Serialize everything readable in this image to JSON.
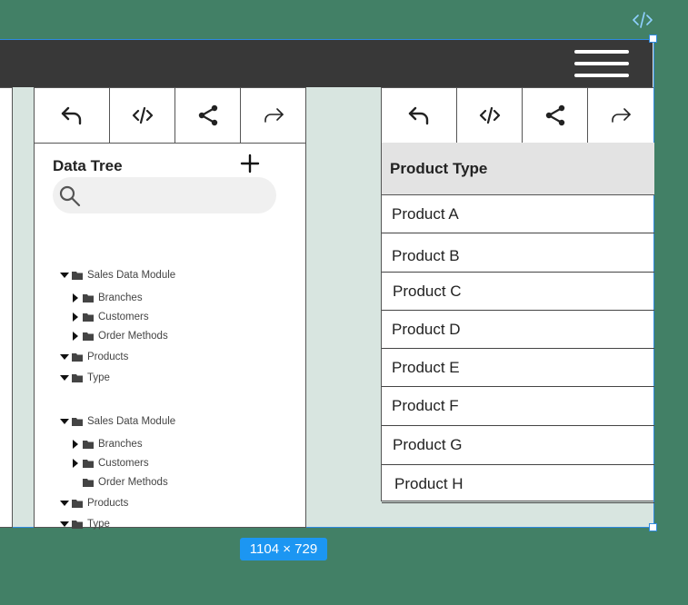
{
  "tree_panel": {
    "title": "Data Tree",
    "search_placeholder": "",
    "groups": [
      {
        "root": "Sales Data Module",
        "children": [
          "Branches",
          "Customers",
          "Order Methods"
        ],
        "siblings": [
          "Products",
          "Type"
        ]
      },
      {
        "root": "Sales Data Module",
        "children": [
          "Branches",
          "Customers",
          "Order Methods"
        ],
        "siblings": [
          "Products",
          "Type"
        ]
      }
    ]
  },
  "table_panel": {
    "header": "Product Type",
    "rows": [
      "Product A",
      "Product B",
      "Product C",
      "Product D",
      "Product E",
      "Product F",
      "Product G",
      "Product H"
    ]
  },
  "toolbar_icons": [
    "undo-icon",
    "code-icon",
    "share-icon",
    "redo-icon"
  ],
  "frame_size_badge": "1104 × 729",
  "colors": {
    "background": "#428066",
    "frame_fill": "#d8e5e0",
    "topbar": "#383838",
    "selection_blue": "#2f8ae0",
    "badge_blue": "#1c96f2"
  }
}
